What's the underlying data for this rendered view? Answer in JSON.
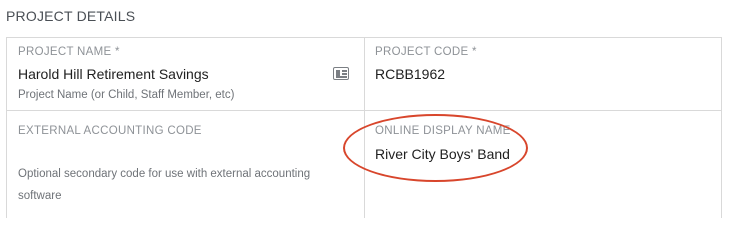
{
  "section": {
    "title": "PROJECT DETAILS"
  },
  "fields": {
    "project_name": {
      "label": "PROJECT NAME *",
      "value": "Harold Hill Retirement Savings",
      "help": "Project Name (or Child, Staff Member, etc)",
      "icon": "contact-card-icon"
    },
    "project_code": {
      "label": "PROJECT CODE *",
      "value": "RCBB1962"
    },
    "external_accounting_code": {
      "label": "EXTERNAL ACCOUNTING CODE",
      "value": "",
      "help": "Optional secondary code for use with external accounting software"
    },
    "online_display_name": {
      "label": "ONLINE DISPLAY NAME",
      "value": "River City Boys' Band"
    }
  },
  "annotation": {
    "highlight_color": "#d8462c"
  }
}
